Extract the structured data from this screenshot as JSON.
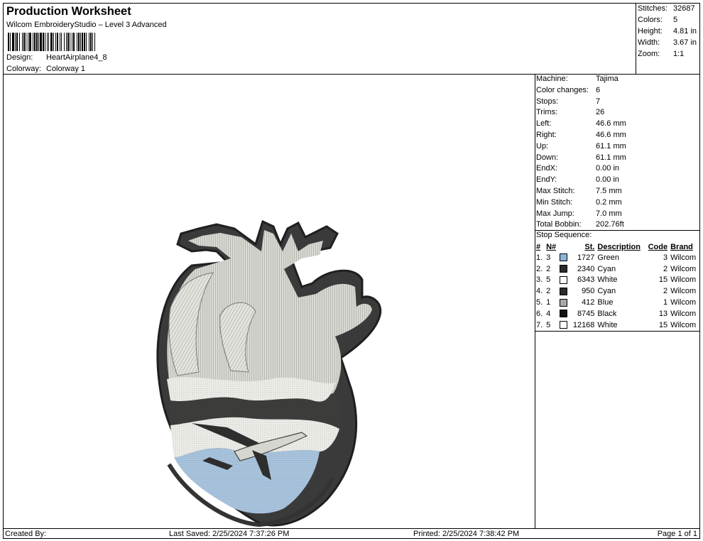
{
  "header": {
    "title": "Production Worksheet",
    "software": "Wilcom EmbroideryStudio – Level 3 Advanced",
    "design_label": "Design:",
    "design_value": "HeartAirplane4_8",
    "colorway_label": "Colorway:",
    "colorway_value": "Colorway 1"
  },
  "stats": [
    {
      "label": "Stitches:",
      "value": "32687"
    },
    {
      "label": "Colors:",
      "value": "5"
    },
    {
      "label": "Height:",
      "value": "4.81 in"
    },
    {
      "label": "Width:",
      "value": "3.67 in"
    },
    {
      "label": "Zoom:",
      "value": "1:1"
    }
  ],
  "machine_info": [
    {
      "label": "Machine:",
      "value": "Tajima"
    },
    {
      "label": "Color changes:",
      "value": "6"
    },
    {
      "label": "Stops:",
      "value": "7"
    },
    {
      "label": "Trims:",
      "value": "26"
    },
    {
      "label": "Left:",
      "value": "46.6 mm"
    },
    {
      "label": "Right:",
      "value": "46.6 mm"
    },
    {
      "label": "Up:",
      "value": "61.1 mm"
    },
    {
      "label": "Down:",
      "value": "61.1 mm"
    },
    {
      "label": "EndX:",
      "value": "0.00 in"
    },
    {
      "label": "EndY:",
      "value": "0.00 in"
    },
    {
      "label": "Max Stitch:",
      "value": "7.5 mm"
    },
    {
      "label": "Min Stitch:",
      "value": "0.2 mm"
    },
    {
      "label": "Max Jump:",
      "value": "7.0 mm"
    },
    {
      "label": "Total Bobbin:",
      "value": "202.76ft"
    }
  ],
  "stop_sequence": {
    "title": "Stop Sequence:",
    "headers": [
      "#",
      "N#",
      "St.",
      "Description",
      "Code",
      "Brand"
    ],
    "rows": [
      {
        "num": "1.",
        "n": "3",
        "color": "#8eb4d8",
        "st": "1727",
        "desc": "Green",
        "code": "3",
        "brand": "Wilcom"
      },
      {
        "num": "2.",
        "n": "2",
        "color": "#2b2b2b",
        "st": "2340",
        "desc": "Cyan",
        "code": "2",
        "brand": "Wilcom"
      },
      {
        "num": "3.",
        "n": "5",
        "color": "#ffffff",
        "st": "6343",
        "desc": "White",
        "code": "15",
        "brand": "Wilcom"
      },
      {
        "num": "4.",
        "n": "2",
        "color": "#2b2b2b",
        "st": "950",
        "desc": "Cyan",
        "code": "2",
        "brand": "Wilcom"
      },
      {
        "num": "5.",
        "n": "1",
        "color": "#a8a8a8",
        "st": "412",
        "desc": "Blue",
        "code": "1",
        "brand": "Wilcom"
      },
      {
        "num": "6.",
        "n": "4",
        "color": "#111111",
        "st": "8745",
        "desc": "Black",
        "code": "13",
        "brand": "Wilcom"
      },
      {
        "num": "7.",
        "n": "5",
        "color": "#ffffff",
        "st": "12168",
        "desc": "White",
        "code": "15",
        "brand": "Wilcom"
      }
    ]
  },
  "footer": {
    "created_by": "Created By:",
    "last_saved": "Last Saved: 2/25/2024 7:37:26 PM",
    "printed": "Printed: 2/25/2024 7:38:42 PM",
    "page": "Page 1 of 1"
  },
  "design_preview_icon": "heart-airplane-embroidery-image"
}
